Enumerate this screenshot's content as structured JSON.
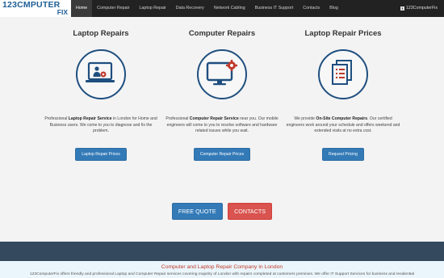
{
  "logo": {
    "line1_a": "123C",
    "line1_b": "MPUTER",
    "line2": "FIX"
  },
  "nav": {
    "items": [
      "Home",
      "Computer Repair",
      "Laptop Repair",
      "Data Recovery",
      "Network Cabling",
      "Business IT Support",
      "Contacts",
      "Blog"
    ],
    "active_index": 0,
    "brand_right": "123ComputerFix"
  },
  "columns": [
    {
      "title": "Laptop Repairs",
      "icon": "laptop-user-gear-icon",
      "text_pre": "Professional ",
      "text_bold": "Laptop Repair Service",
      "text_post": " in London for Home and Business users. We come to you to diagnose and fix the problem.",
      "button": "Laptop Repair Prices"
    },
    {
      "title": "Computer Repairs",
      "icon": "monitor-gear-icon",
      "text_pre": "Professional ",
      "text_bold": "Computer Repair Service",
      "text_post": " near you. Our mobile engineers will come to you to resolve software and hardware related issues while you wait.",
      "button": "Computer Repair Prices"
    },
    {
      "title": "Laptop Repair Prices",
      "icon": "price-list-documents-icon",
      "text_pre": "We provide ",
      "text_bold": "On-Site Computer Repairs",
      "text_post": ". Our certified engineers work around your schedule and offers weekend and extended visits at no extra cost.",
      "button": "Request Pricing"
    }
  ],
  "cta": {
    "free_quote": "FREE QUOTE",
    "contacts": "CONTACTS"
  },
  "footer": {
    "heading": "Computer and Laptop Repair Company in London",
    "text": "123ComputerFix offers friendly and professional Laptop and Computer Repair services covering majority of London with repairs completed at customers premises. We offer IT Support Services for business and residential"
  },
  "colors": {
    "navbar": "#222222",
    "primary": "#337ab7",
    "danger": "#d9534f",
    "icon_blue": "#1f4f7f",
    "icon_red": "#c0392b",
    "band": "#34495e"
  }
}
